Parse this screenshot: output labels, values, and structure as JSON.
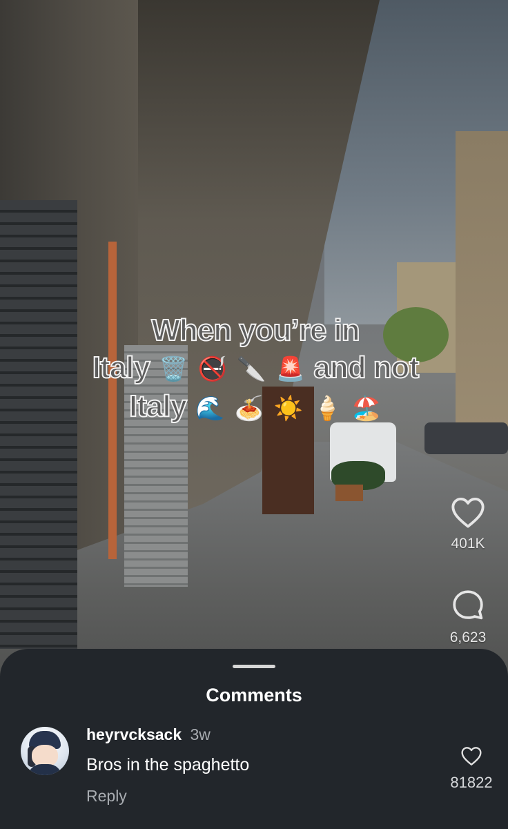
{
  "video": {
    "caption_line1": "When you’re in",
    "caption_line2_a": "Italy",
    "caption_line2_emojis": [
      "🗑️",
      "🚭",
      "🔪",
      "🚨"
    ],
    "caption_line2_b": "and not",
    "caption_line3_a": "Italy",
    "caption_line3_emojis": [
      "🌊",
      "🍝",
      "☀️",
      "🍦",
      "🏖️"
    ]
  },
  "rail": {
    "likes": "401K",
    "comments": "6,623"
  },
  "comments_sheet": {
    "title": "Comments",
    "items": [
      {
        "username": "heyrvcksack",
        "time": "3w",
        "text": "Bros in the spaghetto",
        "reply_label": "Reply",
        "likes": "81822"
      }
    ]
  },
  "colors": {
    "sheet_background": "#22262b",
    "caption_fill": "#5c5c5c",
    "caption_stroke": "#f2f2f2",
    "muted_text": "#a8acb1"
  },
  "icons": {
    "like": "heart-icon",
    "comment": "speech-bubble-icon",
    "comment_like": "heart-icon"
  }
}
